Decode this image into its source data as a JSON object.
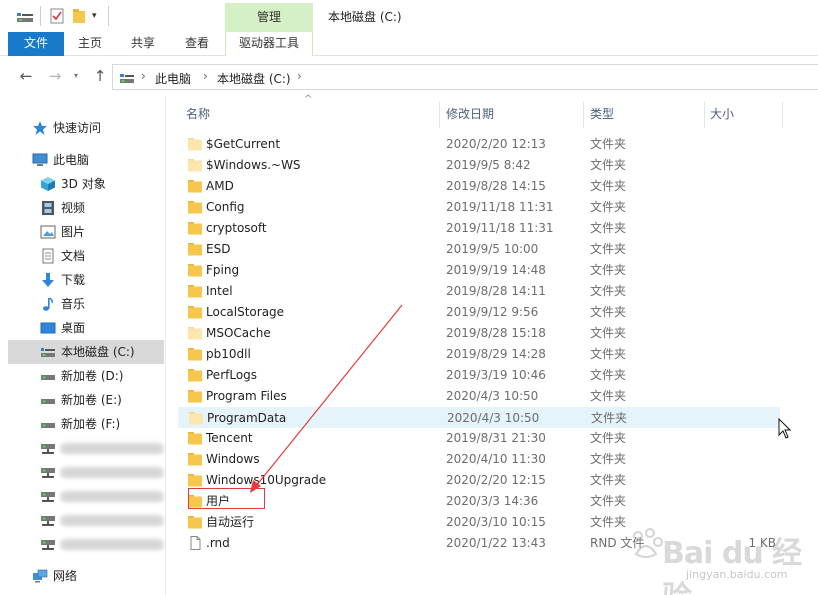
{
  "window": {
    "title": "本地磁盘 (C:)",
    "context_group": "管理"
  },
  "quick_access": {
    "dropdown_glyph": "▾"
  },
  "ribbon": {
    "tabs": [
      {
        "label": "文件"
      },
      {
        "label": "主页"
      },
      {
        "label": "共享"
      },
      {
        "label": "查看"
      },
      {
        "label": "驱动器工具"
      }
    ]
  },
  "nav": {
    "back_glyph": "←",
    "forward_glyph": "→",
    "recent_glyph": "▾",
    "up_glyph": "↑",
    "breadcrumb": [
      "此电脑",
      "本地磁盘 (C:)"
    ],
    "separator": "›"
  },
  "sidebar": {
    "items": [
      {
        "label": "快速访问",
        "icon": "star-icon"
      },
      {
        "label": "此电脑",
        "icon": "computer-icon"
      },
      {
        "label": "3D 对象",
        "icon": "cube-icon"
      },
      {
        "label": "视频",
        "icon": "film-icon"
      },
      {
        "label": "图片",
        "icon": "picture-icon"
      },
      {
        "label": "文档",
        "icon": "document-icon"
      },
      {
        "label": "下载",
        "icon": "download-icon"
      },
      {
        "label": "音乐",
        "icon": "music-icon"
      },
      {
        "label": "桌面",
        "icon": "desktop-icon"
      },
      {
        "label": "本地磁盘 (C:)",
        "icon": "drive-icon",
        "selected": true
      },
      {
        "label": "新加卷 (D:)",
        "icon": "drive-icon"
      },
      {
        "label": "新加卷 (E:)",
        "icon": "drive-icon"
      },
      {
        "label": "新加卷 (F:)",
        "icon": "drive-icon"
      },
      {
        "label": "网络",
        "icon": "network-icon"
      }
    ]
  },
  "columns": {
    "name": "名称",
    "modified": "修改日期",
    "type": "类型",
    "size": "大小",
    "sort_glyph": "^"
  },
  "files": [
    {
      "name": "$GetCurrent",
      "modified": "2020/2/20 12:13",
      "type": "文件夹",
      "size": "",
      "kind": "folder-faded"
    },
    {
      "name": "$Windows.~WS",
      "modified": "2019/9/5 8:42",
      "type": "文件夹",
      "size": "",
      "kind": "folder-faded"
    },
    {
      "name": "AMD",
      "modified": "2019/8/28 14:15",
      "type": "文件夹",
      "size": "",
      "kind": "folder"
    },
    {
      "name": "Config",
      "modified": "2019/11/18 11:31",
      "type": "文件夹",
      "size": "",
      "kind": "folder"
    },
    {
      "name": "cryptosoft",
      "modified": "2019/11/18 11:31",
      "type": "文件夹",
      "size": "",
      "kind": "folder"
    },
    {
      "name": "ESD",
      "modified": "2019/9/5 10:00",
      "type": "文件夹",
      "size": "",
      "kind": "folder"
    },
    {
      "name": "Fping",
      "modified": "2019/9/19 14:48",
      "type": "文件夹",
      "size": "",
      "kind": "folder"
    },
    {
      "name": "Intel",
      "modified": "2019/8/28 14:11",
      "type": "文件夹",
      "size": "",
      "kind": "folder"
    },
    {
      "name": "LocalStorage",
      "modified": "2019/9/12 9:56",
      "type": "文件夹",
      "size": "",
      "kind": "folder"
    },
    {
      "name": "MSOCache",
      "modified": "2019/8/28 15:18",
      "type": "文件夹",
      "size": "",
      "kind": "folder-faded"
    },
    {
      "name": "pb10dll",
      "modified": "2019/8/29 14:28",
      "type": "文件夹",
      "size": "",
      "kind": "folder"
    },
    {
      "name": "PerfLogs",
      "modified": "2019/3/19 10:46",
      "type": "文件夹",
      "size": "",
      "kind": "folder"
    },
    {
      "name": "Program Files",
      "modified": "2020/4/3 10:50",
      "type": "文件夹",
      "size": "",
      "kind": "folder"
    },
    {
      "name": "ProgramData",
      "modified": "2020/4/3 10:50",
      "type": "文件夹",
      "size": "",
      "kind": "folder-faded",
      "hover": true
    },
    {
      "name": "Tencent",
      "modified": "2019/8/31 21:30",
      "type": "文件夹",
      "size": "",
      "kind": "folder"
    },
    {
      "name": "Windows",
      "modified": "2020/4/10 11:30",
      "type": "文件夹",
      "size": "",
      "kind": "folder"
    },
    {
      "name": "Windows10Upgrade",
      "modified": "2020/2/20 12:15",
      "type": "文件夹",
      "size": "",
      "kind": "folder"
    },
    {
      "name": "用户",
      "modified": "2020/3/3 14:36",
      "type": "文件夹",
      "size": "",
      "kind": "folder"
    },
    {
      "name": "自动运行",
      "modified": "2020/3/10 10:15",
      "type": "文件夹",
      "size": "",
      "kind": "folder"
    },
    {
      "name": ".rnd",
      "modified": "2020/1/22 13:43",
      "type": "RND 文件",
      "size": "1 KB",
      "kind": "file"
    }
  ],
  "watermark": {
    "brand": "Bai du 经验",
    "url": "jingyan.baidu.com"
  },
  "colors": {
    "file_tab": "#1979ca",
    "context_group": "#d5f0c4",
    "folder": "#f7c64c",
    "annotation": "#e23c3c",
    "hover_row": "#e5f3fb",
    "selected_sidebar": "#d9d9d9"
  }
}
